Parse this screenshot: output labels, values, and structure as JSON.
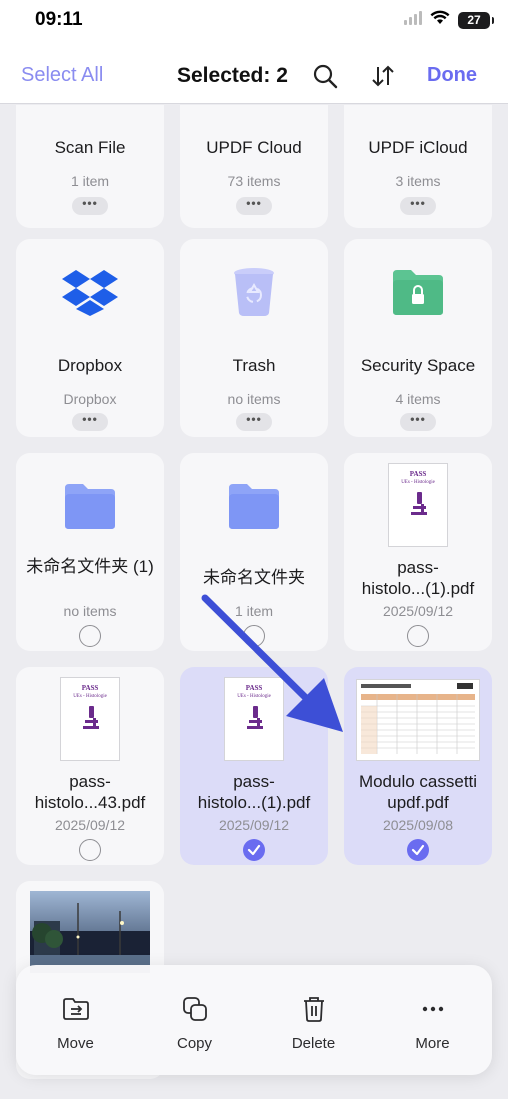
{
  "status": {
    "time": "09:11",
    "battery": "27"
  },
  "nav": {
    "select_all": "Select All",
    "title": "Selected: 2",
    "done": "Done"
  },
  "cards": [
    {
      "name": "Scan File",
      "sub": "1 item",
      "icon": "scan-file-folder-icon"
    },
    {
      "name": "UPDF Cloud",
      "sub": "73 items",
      "icon": "cloud-folder-icon"
    },
    {
      "name": "UPDF iCloud",
      "sub": "3 items",
      "icon": "icloud-folder-icon"
    },
    {
      "name": "Dropbox",
      "sub": "Dropbox",
      "icon": "dropbox-icon"
    },
    {
      "name": "Trash",
      "sub": "no items",
      "icon": "trash-icon"
    },
    {
      "name": "Security Space",
      "sub": "4 items",
      "icon": "lock-folder-icon"
    },
    {
      "name": "未命名文件夹 (1)",
      "sub": "no items",
      "icon": "folder-icon",
      "selected": false
    },
    {
      "name": "未命名文件夹",
      "sub": "1 item",
      "icon": "folder-icon",
      "selected": false
    },
    {
      "name_line1": "pass-",
      "name_line2": "histolo...(1).pdf",
      "sub": "2025/09/12",
      "icon": "pdf-thumbnail",
      "selected": false
    },
    {
      "name_line1": "pass-",
      "name_line2": "histolo...43.pdf",
      "sub": "2025/09/12",
      "icon": "pdf-thumbnail",
      "selected": false
    },
    {
      "name_line1": "pass-",
      "name_line2": "histolo...(1).pdf",
      "sub": "2025/09/12",
      "icon": "pdf-thumbnail",
      "selected": true
    },
    {
      "name_line1": "Modulo cassetti",
      "name_line2": "updf.pdf",
      "sub": "2025/09/08",
      "icon": "spreadsheet-thumbnail",
      "selected": true
    }
  ],
  "thumb_text": {
    "pass": "PASS",
    "histo": "UEs - Histologie"
  },
  "toolbar": {
    "move": "Move",
    "copy": "Copy",
    "delete": "Delete",
    "more": "More"
  },
  "colors": {
    "accent": "#6a6cf0",
    "selected_bg": "#dcdcf8",
    "annotation_arrow": "#3d4fd6"
  }
}
